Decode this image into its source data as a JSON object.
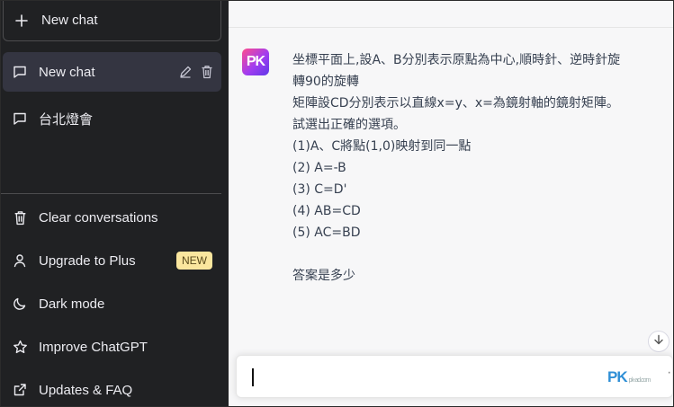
{
  "sidebar": {
    "new_chat_label": "New chat",
    "conversations": [
      {
        "label": "New chat",
        "active": true
      },
      {
        "label": "台北燈會",
        "active": false
      }
    ],
    "menu": {
      "clear": "Clear conversations",
      "upgrade": "Upgrade to Plus",
      "upgrade_badge": "NEW",
      "dark_mode": "Dark mode",
      "improve": "Improve ChatGPT",
      "updates": "Updates & FAQ"
    }
  },
  "main": {
    "avatar_text": "PK",
    "message_lines": [
      "坐標平面上,設A、B分別表示原點為中心,順時針、逆時針旋",
      "轉90的旋轉",
      "矩陣設CD分別表示以直線x=y、x=為鏡射軸的鏡射矩陣。",
      "試選出正確的選項。",
      "(1)A、C將點(1,0)映射到同一點",
      "(2) A=-B",
      "(3) C=D'",
      "(4) AB=CD",
      "(5) AC=BD",
      "",
      "答案是多少"
    ],
    "watermark": "PK",
    "watermark_sub": "pk-ad.com",
    "more": "···"
  },
  "icons": {
    "plus": "plus-icon",
    "chat": "message-icon",
    "edit": "pencil-icon",
    "delete": "trash-icon",
    "clear": "trash-icon",
    "user": "user-icon",
    "moon": "moon-icon",
    "star": "star-icon",
    "external": "external-link-icon",
    "scroll": "arrow-down-icon"
  },
  "colors": {
    "sidebar_bg": "#202123",
    "active_item_bg": "#343541",
    "main_bg": "#f7f7f8",
    "badge_bg": "#fae69e",
    "text": "#374151"
  }
}
